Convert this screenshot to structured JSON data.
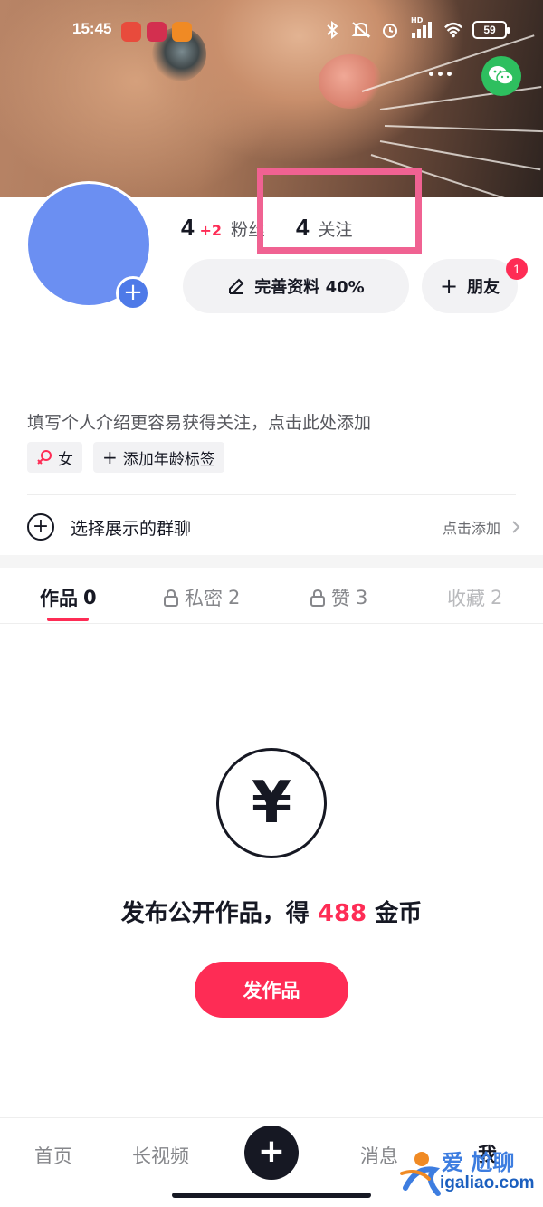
{
  "status_bar": {
    "time": "15:45",
    "battery": "59",
    "hd_label": "HD"
  },
  "profile": {
    "followers_count": "4",
    "followers_delta": "+2",
    "followers_label": "粉丝",
    "following_count": "4",
    "following_label": "关注",
    "edit_profile_label": "完善资料 40%",
    "friends_label": "朋友",
    "friends_badge": "1",
    "bio_placeholder": "填写个人介绍更容易获得关注，点击此处添加",
    "gender_tag": "女",
    "age_tag": "添加年龄标签",
    "group_chat_label": "选择展示的群聊",
    "group_chat_action": "点击添加"
  },
  "tabs": [
    {
      "label": "作品",
      "count": "0"
    },
    {
      "label": "私密",
      "count": "2"
    },
    {
      "label": "赞",
      "count": "3"
    },
    {
      "label": "收藏",
      "count": "2"
    }
  ],
  "empty_state": {
    "yen_symbol": "¥",
    "promo_prefix": "发布公开作品，得",
    "promo_amount": "488",
    "promo_suffix": "金币",
    "publish_button": "发作品"
  },
  "bottom_nav": {
    "home": "首页",
    "long_video": "长视频",
    "messages": "消息",
    "me": "我"
  },
  "watermark": {
    "text": "爱 尬聊",
    "url": "igaliao.com"
  },
  "colors": {
    "accent": "#fe2c55",
    "highlight_box": "#f06292",
    "wechat": "#2ebf5f",
    "avatar": "#6b8ff2"
  }
}
